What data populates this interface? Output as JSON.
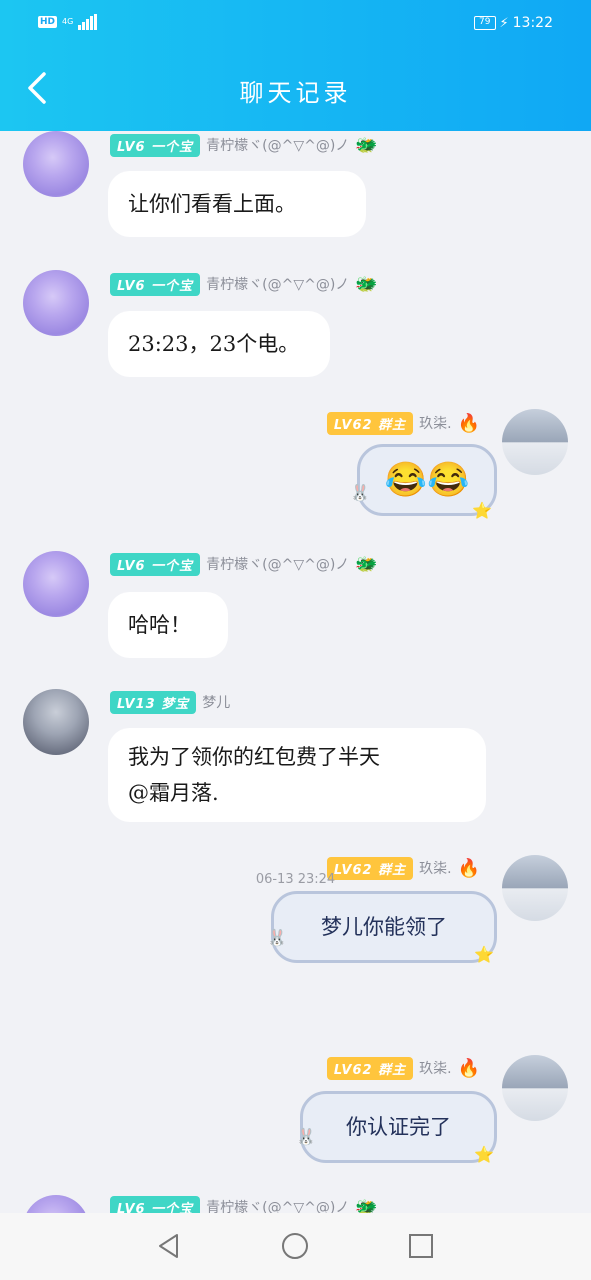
{
  "status_bar": {
    "hd": "HD",
    "network": "4G",
    "battery": "79",
    "time": "13:22"
  },
  "header": {
    "title": "聊天记录"
  },
  "messages": [
    {
      "level": "LV6",
      "title": "一个宝",
      "name": "青柠檬ヾ(@^▽^@)ノ",
      "text": "让你们看看上面。"
    },
    {
      "level": "LV6",
      "title": "一个宝",
      "name": "青柠檬ヾ(@^▽^@)ノ",
      "text": "23:23，23个电。"
    },
    {
      "level": "LV62",
      "title": "群主",
      "name": "玖柒.",
      "text": "😂😂"
    },
    {
      "level": "LV6",
      "title": "一个宝",
      "name": "青柠檬ヾ(@^▽^@)ノ",
      "text": "哈哈！"
    },
    {
      "level": "LV13",
      "title": "梦宝",
      "name": "梦儿",
      "text_line1": "我为了领你的红包费了半天",
      "text_line2": "@霜月落."
    },
    {
      "level": "LV62",
      "title": "群主",
      "name": "玖柒.",
      "text": "梦儿你能领了"
    },
    {
      "level": "LV62",
      "title": "群主",
      "name": "玖柒.",
      "text": "你认证完了"
    },
    {
      "level": "LV6",
      "title": "一个宝",
      "name": "青柠檬ヾ(@^▽^@)ノ"
    }
  ],
  "timestamp": "06-13 23:24",
  "icons": {
    "back": "chevron-left-icon",
    "nav_back": "triangle-back-icon",
    "nav_home": "circle-home-icon",
    "nav_recent": "square-recent-icon"
  },
  "colors": {
    "header_start": "#1cc6f2",
    "header_end": "#10a8f4",
    "level_teal": "#3fd6c6",
    "level_gold": "#ffc53d"
  }
}
